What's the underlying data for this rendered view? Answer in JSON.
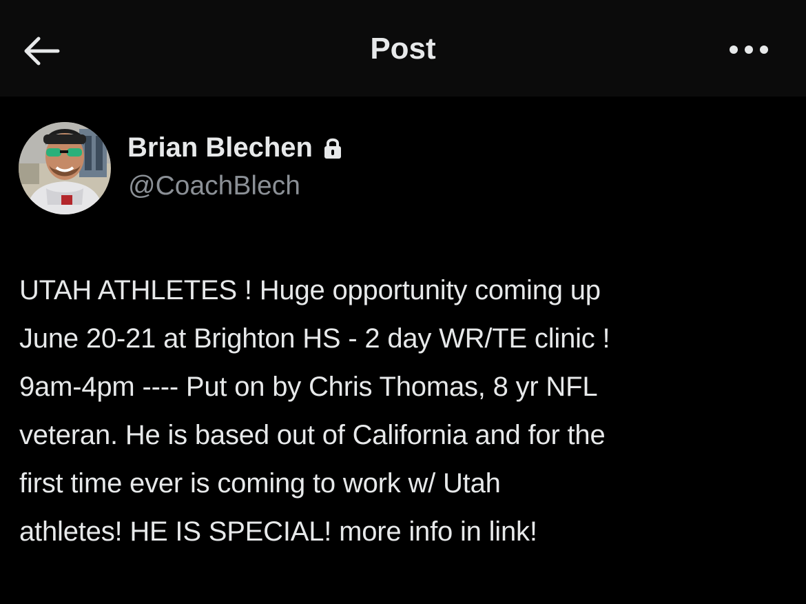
{
  "header": {
    "title": "Post",
    "back_icon": "arrow-left-icon",
    "more_icon": "more-horizontal-icon"
  },
  "author": {
    "display_name": "Brian Blechen",
    "handle": "@CoachBlech",
    "protected_icon": "lock-icon",
    "avatar_icon": "avatar-photo"
  },
  "post": {
    "text": "UTAH ATHLETES !  Huge opportunity coming up\nJune 20-21 at Brighton HS - 2 day WR/TE clinic !\n9am-4pm ---- Put on by Chris Thomas, 8 yr NFL\nveteran.  He is based out of California and for the\nfirst time ever is coming to work w/ Utah\nathletes! HE IS SPECIAL! more info in link!"
  },
  "colors": {
    "background": "#000000",
    "header_background": "#0b0b0b",
    "primary_text": "#e7e9ea",
    "secondary_text": "#8b9096"
  }
}
